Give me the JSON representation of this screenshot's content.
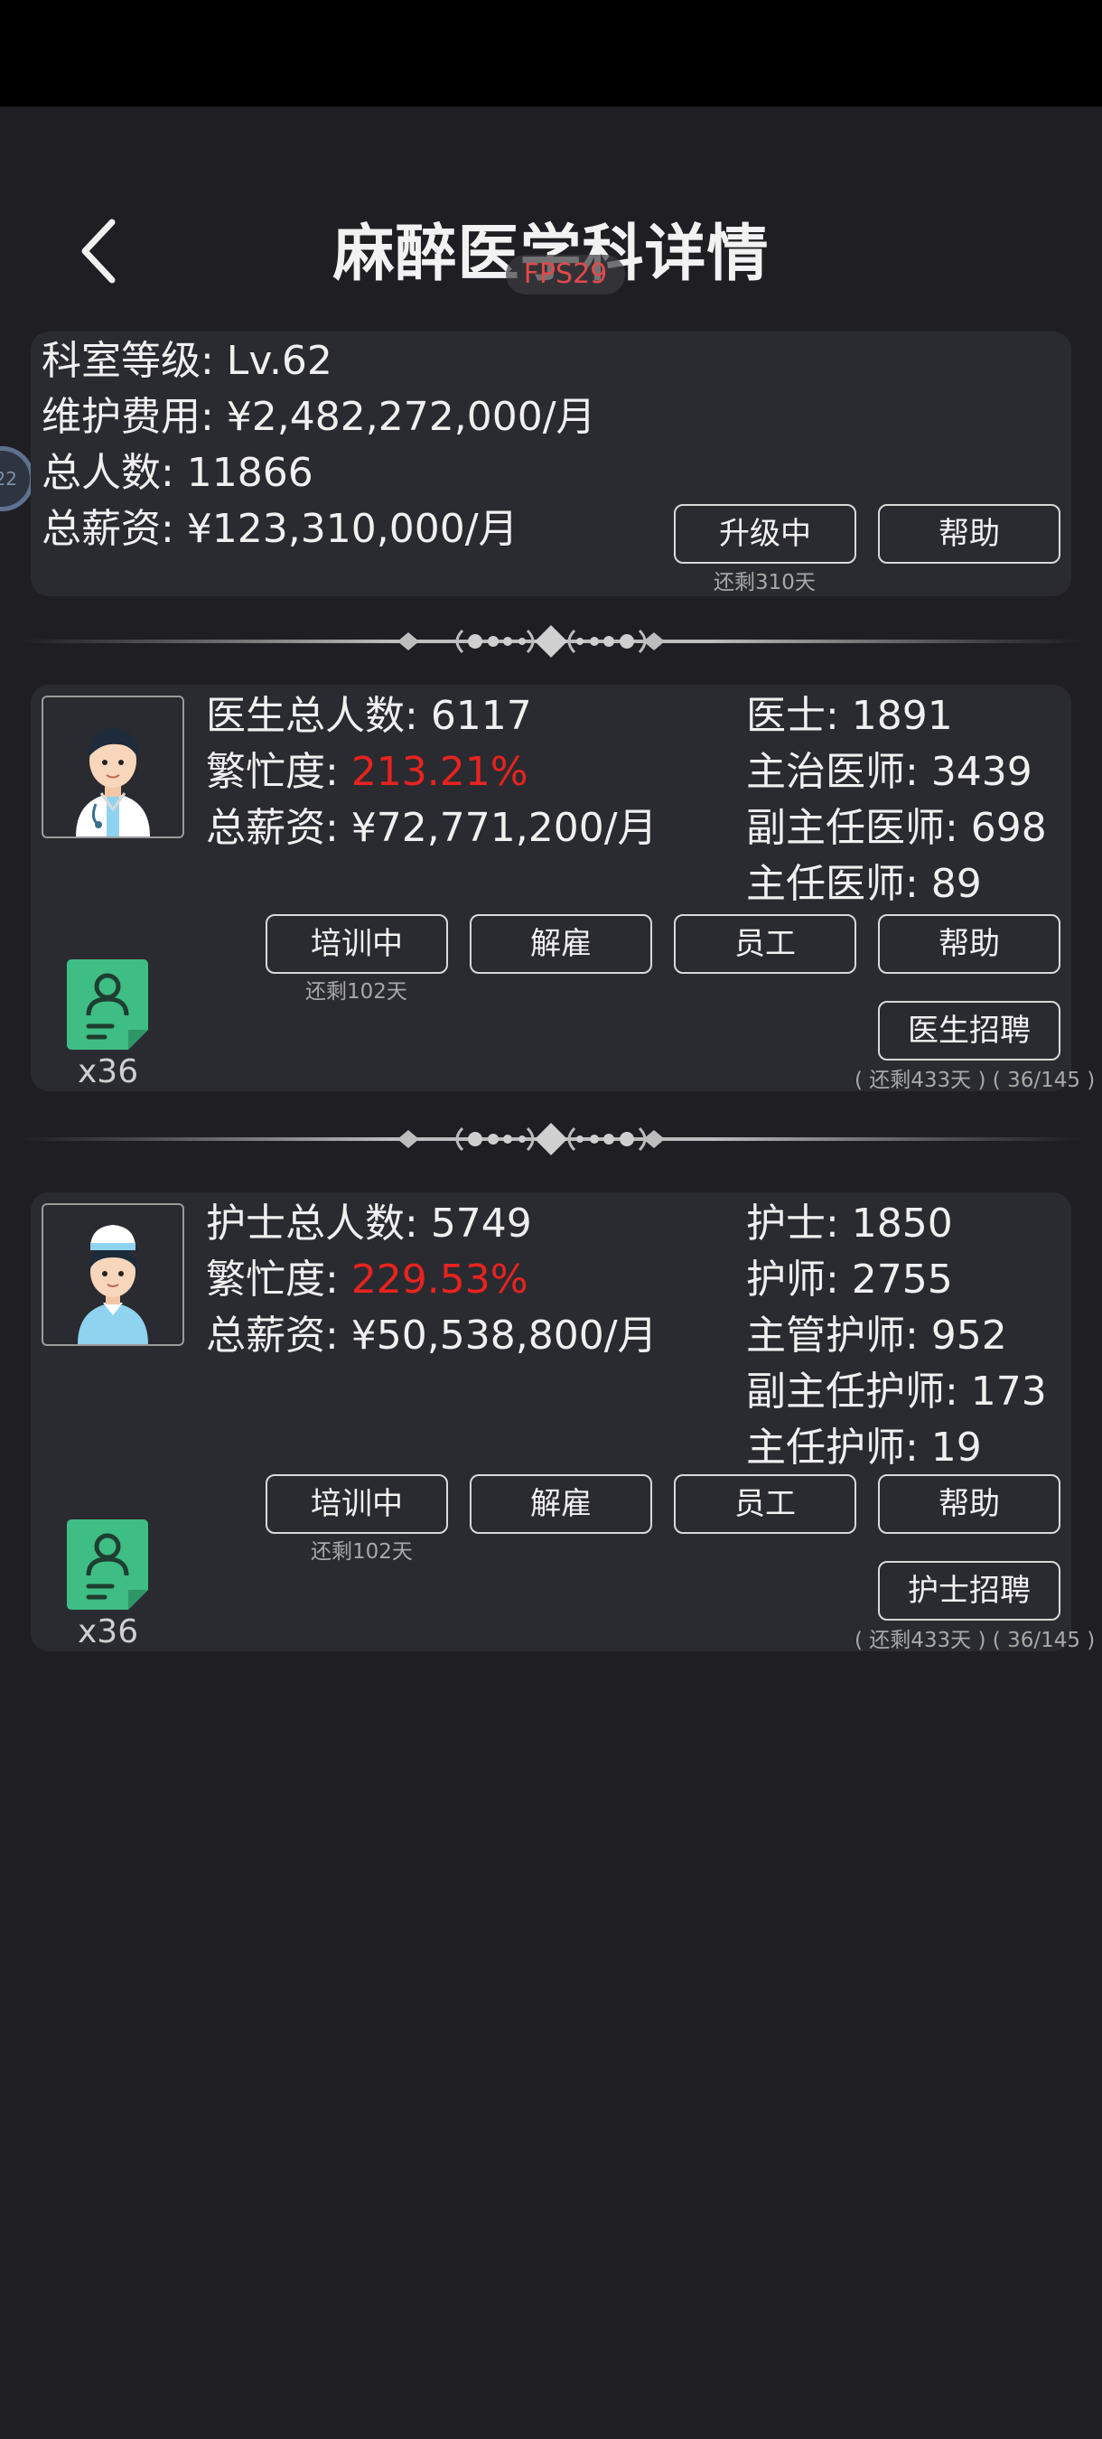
{
  "header": {
    "title": "麻醉医学科详情",
    "fps": "FPS29",
    "side_bubble": "22"
  },
  "department": {
    "level": "科室等级: Lv.62",
    "maintenance": "维护费用: ¥2,482,272,000/月",
    "headcount": "总人数: 11866",
    "salary": "总薪资: ¥123,310,000/月",
    "upgrade_button": "升级中",
    "upgrade_remaining": "还剩310天",
    "help_button": "帮助"
  },
  "doctors": {
    "total_label": "医生总人数: ",
    "total_value": "6117",
    "busy_label": "繁忙度: ",
    "busy_value": "213.21%",
    "salary": "总薪资: ¥72,771,200/月",
    "ranks": [
      "医士: 1891",
      "主治医师: 3439",
      "副主任医师: 698",
      "主任医师: 89"
    ],
    "buttons": {
      "train": "培训中",
      "fire": "解雇",
      "staff": "员工",
      "help": "帮助",
      "recruit": "医生招聘"
    },
    "train_remaining": "还剩102天",
    "recruit_info": "( 还剩433天 ) ( 36/145 )",
    "ticket_count": "x36"
  },
  "nurses": {
    "total_label": "护士总人数: ",
    "total_value": "5749",
    "busy_label": "繁忙度: ",
    "busy_value": "229.53%",
    "salary": "总薪资: ¥50,538,800/月",
    "ranks": [
      "护士: 1850",
      "护师: 2755",
      "主管护师: 952",
      "副主任护师: 173",
      "主任护师: 19"
    ],
    "buttons": {
      "train": "培训中",
      "fire": "解雇",
      "staff": "员工",
      "help": "帮助",
      "recruit": "护士招聘"
    },
    "train_remaining": "还剩102天",
    "recruit_info": "( 还剩433天 ) ( 36/145 )",
    "ticket_count": "x36"
  },
  "colors": {
    "background": "#1f1f23",
    "card": "#2a2b30",
    "warning_red": "#e8231f",
    "ticket_green": "#3ebd84"
  },
  "icons": [
    "back-arrow-icon",
    "doctor-avatar-icon",
    "nurse-avatar-icon",
    "recruit-ticket-icon",
    "ornament-divider"
  ]
}
